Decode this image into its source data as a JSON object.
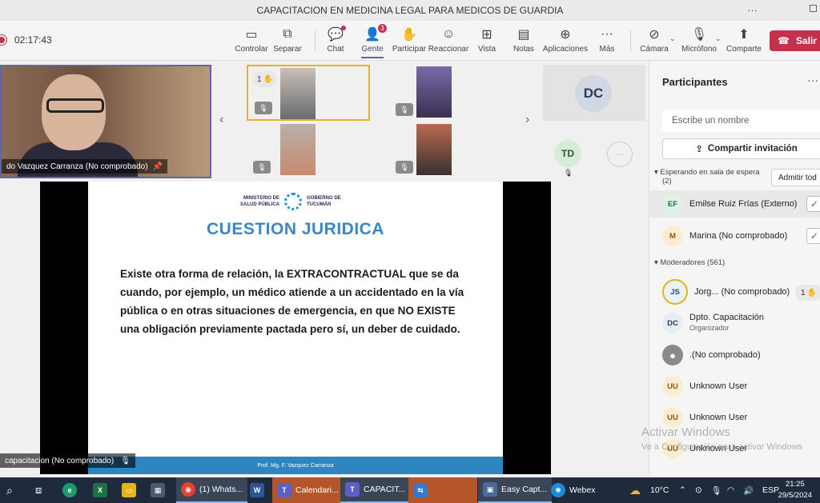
{
  "window": {
    "title": "CAPACITACION EN MEDICINA LEGAL PARA MEDICOS DE GUARDIA",
    "more": "···"
  },
  "toolbar": {
    "timer": "02:17:43",
    "buttons": [
      {
        "label": "Controlar",
        "icon": "screen-control-icon"
      },
      {
        "label": "Separar",
        "icon": "pop-out-icon"
      },
      {
        "label": "Chat",
        "icon": "chat-icon"
      },
      {
        "label": "Gente",
        "icon": "people-icon",
        "badge": "3"
      },
      {
        "label": "Participar",
        "icon": "raise-hand-icon"
      },
      {
        "label": "Reaccionar",
        "icon": "smiley-icon"
      },
      {
        "label": "Vista",
        "icon": "grid-view-icon"
      },
      {
        "label": "Notas",
        "icon": "notes-icon"
      },
      {
        "label": "Aplicaciones",
        "icon": "add-apps-icon"
      },
      {
        "label": "Más",
        "icon": "more-icon"
      },
      {
        "label": "Cámara",
        "icon": "camera-off-icon"
      },
      {
        "label": "Micrófono",
        "icon": "mic-off-icon"
      },
      {
        "label": "Comparte",
        "icon": "share-icon"
      }
    ],
    "leave_label": "Salir",
    "active_color": "#5b5fc7",
    "leave_color": "#c4314b"
  },
  "stage": {
    "speaker_name": "do Vazquez Carranza (No comprobado)",
    "hand_count": "1",
    "dc_initials": "DC",
    "td_initials": "TD",
    "screen_share_name": "capacitacion (No comprobado)"
  },
  "slide": {
    "logo_left_line1": "MINISTERIO DE",
    "logo_left_line2": "SALUD PÚBLICA",
    "logo_right_line1": "GOBIERNO DE",
    "logo_right_line2": "TUCUMÁN",
    "title": "CUESTION JURIDICA",
    "body": "Existe otra forma de relación, la EXTRACONTRACTUAL que se da cuando, por ejemplo, un médico atiende a un accidentado en la vía pública o en otras situaciones de emergencia, en que NO EXISTE una obligación previamente pactada pero sí, un deber de cuidado.",
    "footer": "Prof. Mg. F. Vazquez Carranza",
    "title_color": "#3b86c8"
  },
  "panel": {
    "title": "Participantes",
    "search_placeholder": "Escribe un nombre",
    "share_label": "Compartir invitación",
    "waiting_section": "Esperando en sala de espera",
    "waiting_count": "(2)",
    "admit_all": "Admitir tod",
    "waiting": [
      {
        "initials": "EF",
        "name": "Emilse Ruiz Frías (Externo)",
        "color": "#dff0e4"
      },
      {
        "initials": "M",
        "name": "Marina (No comprobado)",
        "color": "#fbeed0"
      }
    ],
    "moderators_section": "Moderadores (561)",
    "moderators": [
      {
        "initials": "JS",
        "name": "Jorg... (No comprobado)",
        "sub": "",
        "hand": "1",
        "color": "#e8f2fb"
      },
      {
        "initials": "DC",
        "name": "Dpto. Capacitación",
        "sub": "Organizador",
        "color": "#e6edf5"
      },
      {
        "initials": "",
        "name": ".(No comprobado)",
        "sub": "",
        "color": "#8a8a8a"
      },
      {
        "initials": "UU",
        "name": "Unknown User",
        "sub": "",
        "color": "#fbeed0"
      },
      {
        "initials": "UU",
        "name": "Unknown User",
        "sub": "",
        "color": "#fbeed0"
      },
      {
        "initials": "UU",
        "name": "Unknown User",
        "sub": "",
        "color": "#fbeed0"
      }
    ]
  },
  "watermark": {
    "line1": "Activar Windows",
    "line2": "Ve a Configuración para activar Windows"
  },
  "taskbar": {
    "apps": [
      {
        "label": "(1) Whats...",
        "icon": "chrome-icon"
      },
      {
        "label": "",
        "icon": "word-icon"
      },
      {
        "label": "Calendari...",
        "icon": "teams-icon"
      },
      {
        "label": "CAPACIT...",
        "icon": "teams-icon"
      },
      {
        "label": "",
        "icon": "teams-share-icon"
      },
      {
        "label": "Easy Capt...",
        "icon": "easy-capture-icon"
      },
      {
        "label": "Webex",
        "icon": "webex-icon"
      }
    ],
    "temperature": "10°C",
    "language": "ESP",
    "time": "21:25",
    "date": "29/5/2024"
  }
}
